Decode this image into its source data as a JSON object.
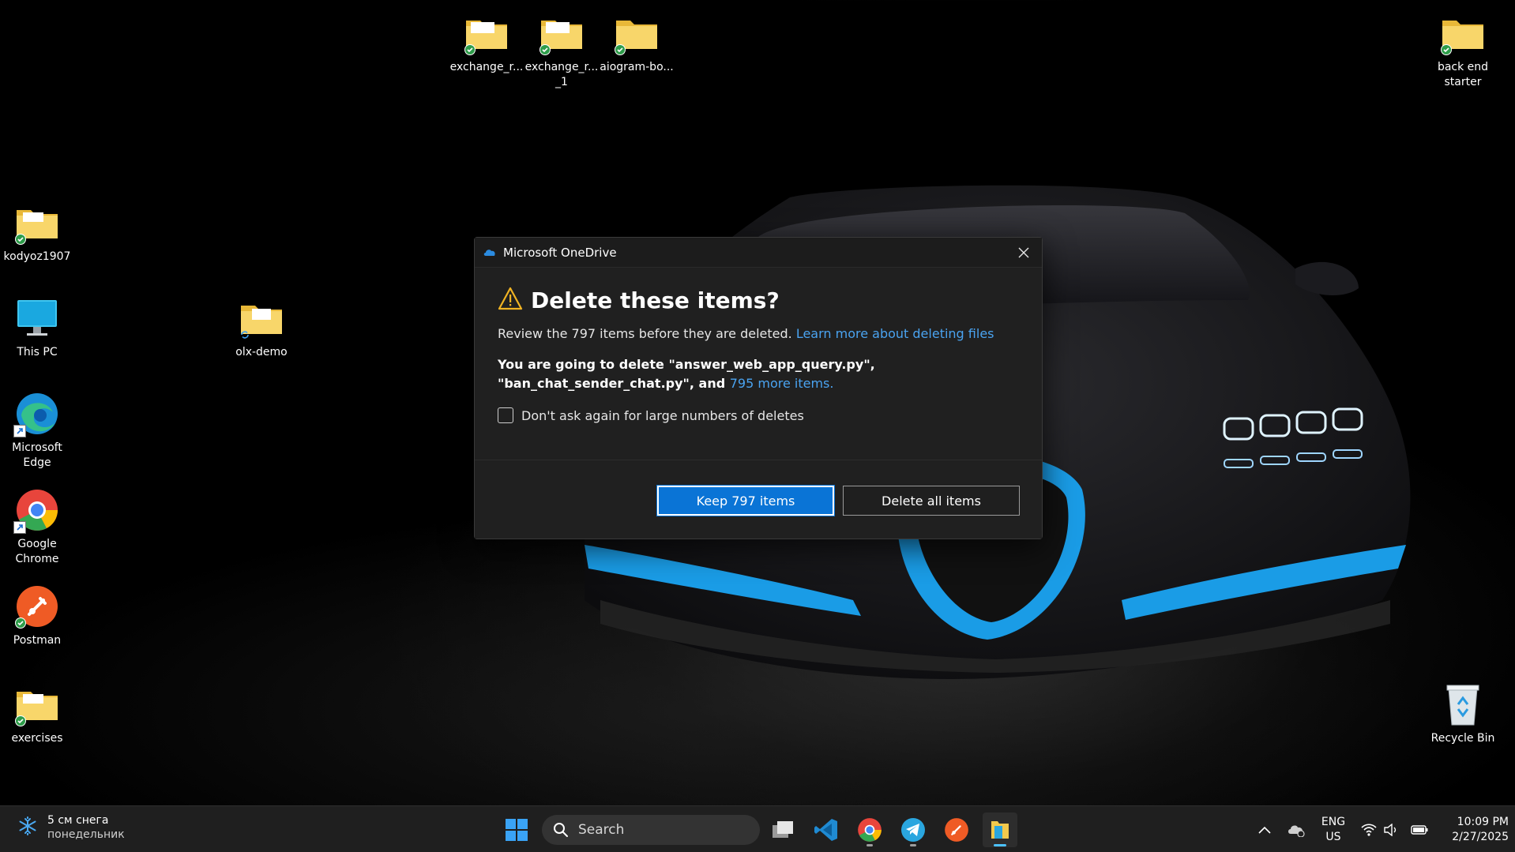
{
  "desktop": {
    "icons": [
      {
        "label": "exchange_r...",
        "type": "folder"
      },
      {
        "label": "exchange_r... _1",
        "type": "folder"
      },
      {
        "label": "aiogram-bo...",
        "type": "folder"
      },
      {
        "label": "back end starter",
        "type": "folder"
      },
      {
        "label": "kodyoz1907",
        "type": "folder"
      },
      {
        "label": "This PC",
        "type": "pc"
      },
      {
        "label": "olx-demo",
        "type": "folder"
      },
      {
        "label": "Microsoft Edge",
        "type": "edge"
      },
      {
        "label": "Google Chrome",
        "type": "chrome"
      },
      {
        "label": "Postman",
        "type": "postman"
      },
      {
        "label": "exercises",
        "type": "folder"
      },
      {
        "label": "Recycle Bin",
        "type": "recycle-bin"
      }
    ]
  },
  "dialog": {
    "app_title": "Microsoft OneDrive",
    "heading": "Delete these items?",
    "review_text": "Review the 797 items before they are deleted.",
    "review_link": "Learn more about deleting files",
    "detail_text": "You are going to delete \"answer_web_app_query.py\", \"ban_chat_sender_chat.py\", and",
    "detail_link": "795 more items.",
    "checkbox_label": "Don't ask again for large numbers of deletes",
    "checkbox_checked": false,
    "keep_button": "Keep 797 items",
    "delete_button": "Delete all items"
  },
  "taskbar": {
    "weather_temp": "5 см снега",
    "weather_day": "понедельник",
    "search_placeholder": "Search",
    "apps": [
      "start-icon",
      "task-view-icon",
      "vscode-icon",
      "chrome-icon",
      "telegram-icon",
      "postman-icon",
      "file-explorer-icon"
    ],
    "lang_primary": "ENG",
    "lang_secondary": "US",
    "time": "10:09 PM",
    "date": "2/27/2025"
  },
  "colors": {
    "accent": "#0a74d6",
    "link": "#4aa3f0",
    "dialog_bg": "#202020",
    "taskbar_bg": "#1f1f1f",
    "car_accent": "#1a9ce6"
  }
}
